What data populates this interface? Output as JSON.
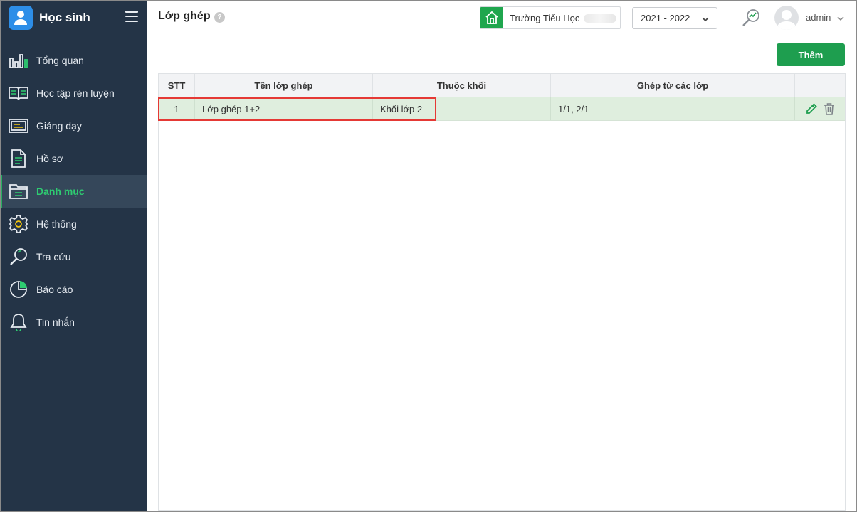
{
  "app": {
    "title": "Học sinh"
  },
  "sidebar": {
    "items": [
      {
        "label": "Tổng quan",
        "icon": "bar-chart-icon",
        "active": false
      },
      {
        "label": "Học tập rèn luyện",
        "icon": "book-icon",
        "active": false
      },
      {
        "label": "Giảng dạy",
        "icon": "presentation-board-icon",
        "active": false
      },
      {
        "label": "Hồ sơ",
        "icon": "document-icon",
        "active": false
      },
      {
        "label": "Danh mục",
        "icon": "folder-icon",
        "active": true
      },
      {
        "label": "Hệ thống",
        "icon": "gear-icon",
        "active": false
      },
      {
        "label": "Tra cứu",
        "icon": "search-icon",
        "active": false
      },
      {
        "label": "Báo cáo",
        "icon": "pie-chart-icon",
        "active": false
      },
      {
        "label": "Tin nhắn",
        "icon": "bell-icon",
        "active": false
      }
    ]
  },
  "header": {
    "page_title": "Lớp ghép",
    "help_label": "?",
    "school_name": "Trường Tiểu Học",
    "school_year": "2021 - 2022",
    "user_name": "admin"
  },
  "toolbar": {
    "add_label": "Thêm"
  },
  "table": {
    "columns": [
      "STT",
      "Tên lớp ghép",
      "Thuộc khối",
      "Ghép từ các lớp",
      ""
    ],
    "rows": [
      {
        "stt": "1",
        "name": "Lớp ghép 1+2",
        "grade": "Khối lớp 2",
        "merged_from": "1/1, 2/1"
      }
    ]
  },
  "colors": {
    "sidebar_bg": "#243447",
    "accent_green": "#1e9e4f",
    "active_text": "#2ecc71",
    "row_bg": "#dfeede",
    "highlight_border": "#e53935"
  }
}
